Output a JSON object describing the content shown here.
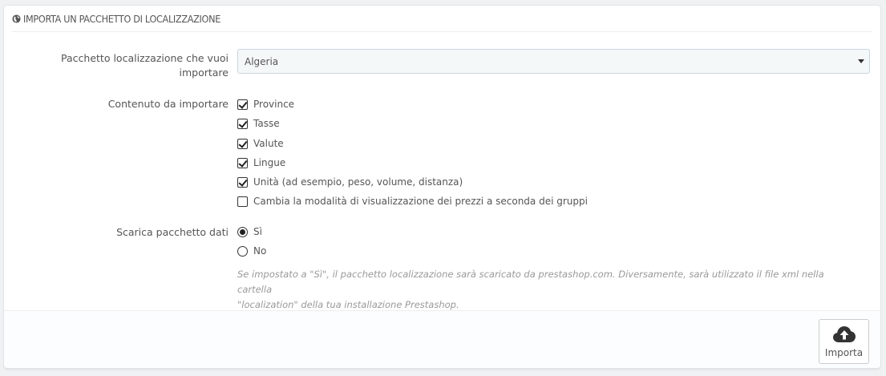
{
  "panel": {
    "title": "IMPORTA UN PACCHETTO DI LOCALIZZAZIONE",
    "title_icon": "globe-icon"
  },
  "pack_field": {
    "label_line1": "Pacchetto localizzazione che vuoi",
    "label_line2": "importare",
    "selected": "Algeria"
  },
  "content_field": {
    "label": "Contenuto da importare",
    "options": [
      {
        "label": "Province",
        "checked": true
      },
      {
        "label": "Tasse",
        "checked": true
      },
      {
        "label": "Valute",
        "checked": true
      },
      {
        "label": "Lingue",
        "checked": true
      },
      {
        "label": "Unità (ad esempio, peso, volume, distanza)",
        "checked": true
      },
      {
        "label": "Cambia la modalità di visualizzazione dei prezzi a seconda dei gruppi",
        "checked": false
      }
    ]
  },
  "download_field": {
    "label": "Scarica pacchetto dati",
    "options": [
      {
        "label": "Sì",
        "checked": true
      },
      {
        "label": "No",
        "checked": false
      }
    ],
    "help_line1": "Se impostato a \"Sì\", il pacchetto localizzazione sarà scaricato da prestashop.com. Diversamente, sarà utilizzato il file xml nella cartella",
    "help_line2": "\"localization\" della tua installazione Prestashop."
  },
  "footer": {
    "import_label": "Importa",
    "import_icon": "cloud-upload-icon"
  }
}
